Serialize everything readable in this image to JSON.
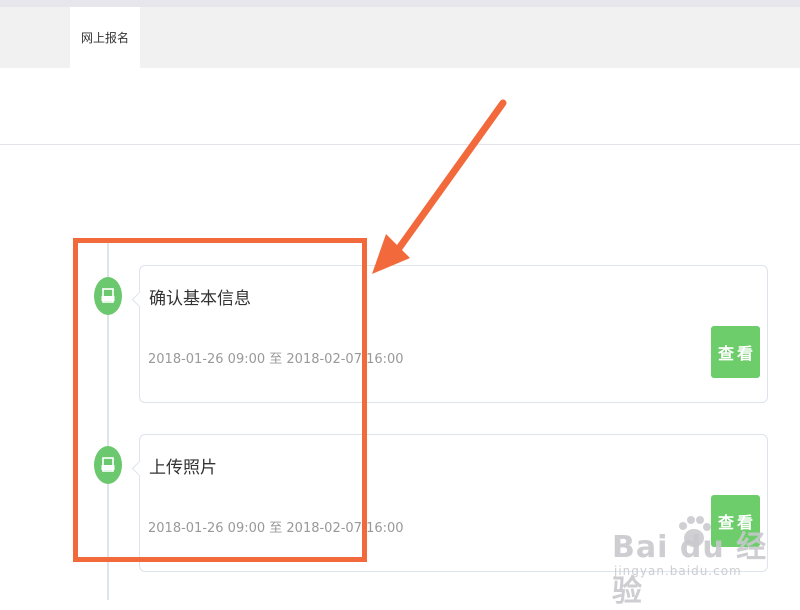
{
  "tabs": [
    {
      "label": "网上报名",
      "active": true
    }
  ],
  "timeline": [
    {
      "title": "确认基本信息",
      "time": "2018-01-26 09:00 至 2018-02-07 16:00",
      "button_label": "查看"
    },
    {
      "title": "上传照片",
      "time": "2018-01-26 09:00 至 2018-02-07 16:00",
      "button_label": "查看"
    }
  ],
  "watermark": {
    "main": "Bai du 经验",
    "sub": "jingyan.baidu.com"
  },
  "colors": {
    "accent_green": "#6ccd6a",
    "annotation_orange": "#f26a3c",
    "border": "#dde4ec"
  },
  "icons": {
    "node": "document-icon",
    "watermark": "paw-icon"
  }
}
